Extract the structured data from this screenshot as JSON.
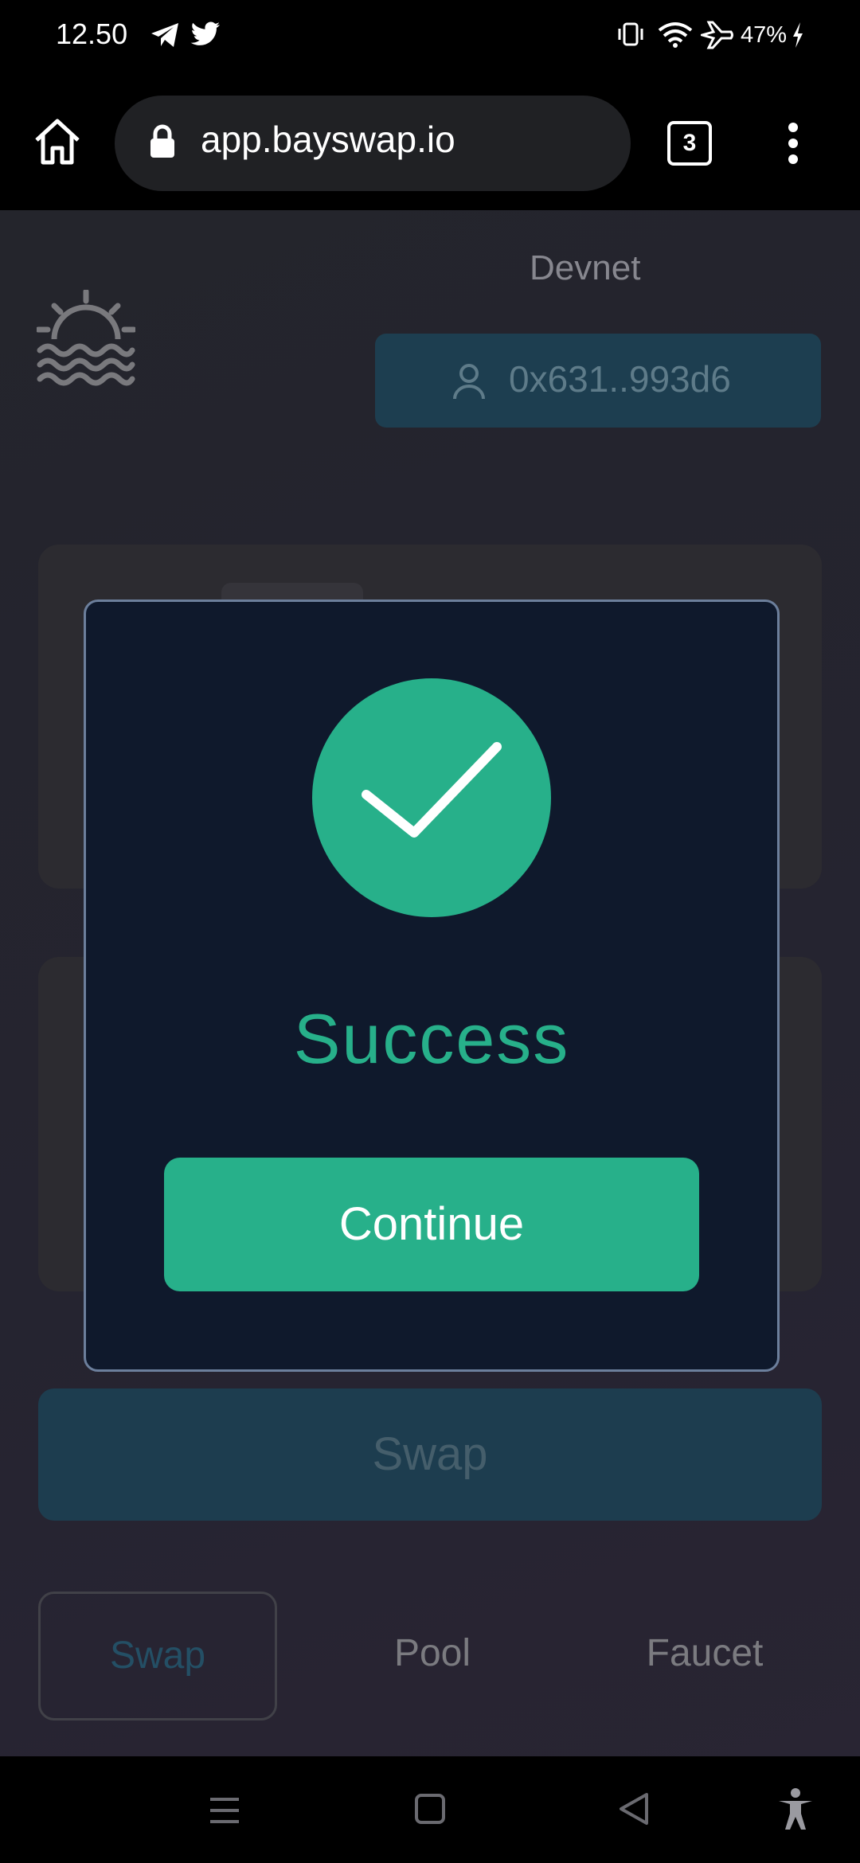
{
  "status_bar": {
    "time": "12.50",
    "battery": "47%"
  },
  "browser": {
    "url": "app.bayswap.io",
    "tab_count": "3"
  },
  "header": {
    "network": "Devnet",
    "wallet_address": "0x631..993d6"
  },
  "main": {
    "swap_button_label": "Swap"
  },
  "bottom_tabs": [
    {
      "label": "Swap",
      "active": true
    },
    {
      "label": "Pool",
      "active": false
    },
    {
      "label": "Faucet",
      "active": false
    }
  ],
  "modal": {
    "title": "Success",
    "button_label": "Continue"
  },
  "colors": {
    "accent": "#27b08a",
    "modal_bg": "#0f192c",
    "wallet_bg": "#22475c"
  }
}
